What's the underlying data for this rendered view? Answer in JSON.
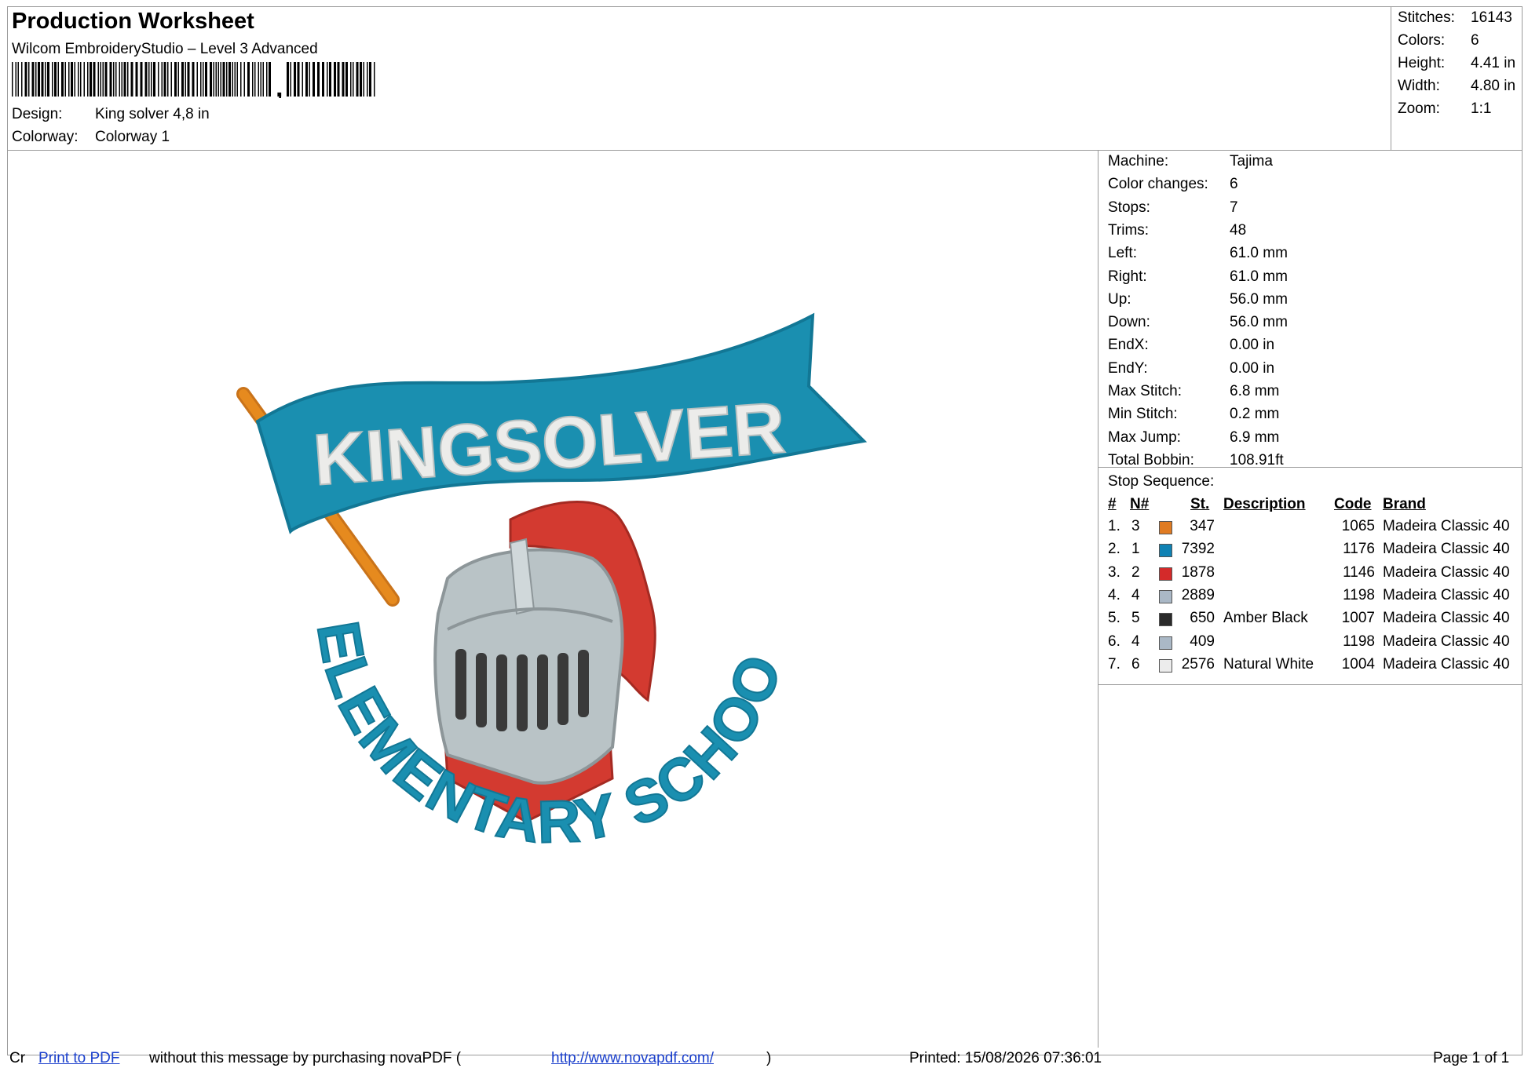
{
  "header": {
    "title": "Production Worksheet",
    "software": "Wilcom EmbroideryStudio – Level 3 Advanced",
    "design_label": "Design:",
    "design_value": "King solver 4,8 in",
    "colorway_label": "Colorway:",
    "colorway_value": "Colorway 1"
  },
  "summary": [
    {
      "label": "Stitches:",
      "value": "16143"
    },
    {
      "label": "Colors:",
      "value": "6"
    },
    {
      "label": "Height:",
      "value": "4.41 in"
    },
    {
      "label": "Width:",
      "value": "4.80 in"
    },
    {
      "label": "Zoom:",
      "value": "1:1"
    }
  ],
  "details": [
    {
      "label": "Machine:",
      "value": "Tajima"
    },
    {
      "label": "Color changes:",
      "value": "6"
    },
    {
      "label": "Stops:",
      "value": "7"
    },
    {
      "label": "Trims:",
      "value": "48"
    },
    {
      "label": "Left:",
      "value": "61.0 mm"
    },
    {
      "label": "Right:",
      "value": "61.0 mm"
    },
    {
      "label": "Up:",
      "value": "56.0 mm"
    },
    {
      "label": "Down:",
      "value": "56.0 mm"
    },
    {
      "label": "EndX:",
      "value": "0.00 in"
    },
    {
      "label": "EndY:",
      "value": "0.00 in"
    },
    {
      "label": "Max Stitch:",
      "value": "6.8 mm"
    },
    {
      "label": "Min Stitch:",
      "value": "0.2 mm"
    },
    {
      "label": "Max Jump:",
      "value": "6.9 mm"
    },
    {
      "label": "Total Bobbin:",
      "value": "108.91ft"
    }
  ],
  "stop_sequence": {
    "title": "Stop Sequence:",
    "headers": {
      "num": "#",
      "needle": "N#",
      "stitches": "St.",
      "description": "Description",
      "code": "Code",
      "brand": "Brand"
    },
    "rows": [
      {
        "num": "1.",
        "needle": "3",
        "color": "#e07b22",
        "stitches": "347",
        "description": "",
        "code": "1065",
        "brand": "Madeira Classic 40"
      },
      {
        "num": "2.",
        "needle": "1",
        "color": "#0f82b4",
        "stitches": "7392",
        "description": "",
        "code": "1176",
        "brand": "Madeira Classic 40"
      },
      {
        "num": "3.",
        "needle": "2",
        "color": "#d42a2a",
        "stitches": "1878",
        "description": "",
        "code": "1146",
        "brand": "Madeira Classic 40"
      },
      {
        "num": "4.",
        "needle": "4",
        "color": "#aab8c6",
        "stitches": "2889",
        "description": "",
        "code": "1198",
        "brand": "Madeira Classic 40"
      },
      {
        "num": "5.",
        "needle": "5",
        "color": "#2a2a2a",
        "stitches": "650",
        "description": "Amber Black",
        "code": "1007",
        "brand": "Madeira Classic 40"
      },
      {
        "num": "6.",
        "needle": "4",
        "color": "#aab8c6",
        "stitches": "409",
        "description": "",
        "code": "1198",
        "brand": "Madeira Classic 40"
      },
      {
        "num": "7.",
        "needle": "6",
        "color": "#ececec",
        "stitches": "2576",
        "description": "Natural White",
        "code": "1004",
        "brand": "Madeira Classic 40"
      }
    ]
  },
  "design_art": {
    "banner_text": "KINGSOLVER",
    "arc_text": "ELEMENTARY SCHOOL",
    "colors": {
      "teal": "#1a8fb0",
      "orange": "#e68a1e",
      "red": "#d33a30",
      "silver": "#b9c3c6",
      "black": "#3a3a3a",
      "white": "#ececea"
    }
  },
  "footer": {
    "prefix": "Cr",
    "link_text": "Print to PDF",
    "message": "without this message by purchasing novaPDF (",
    "url": "http://www.novapdf.com/",
    "suffix": ")",
    "printed": "Printed: 15/08/2026 07:36:01",
    "page": "Page 1 of 1"
  }
}
